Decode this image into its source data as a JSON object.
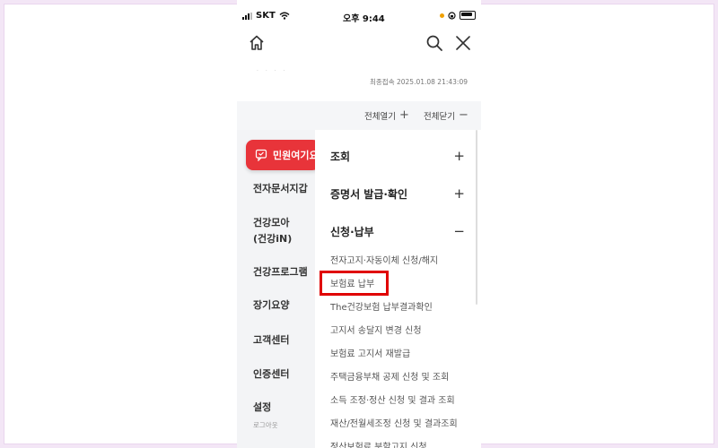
{
  "statusbar": {
    "carrier": "SKT",
    "time": "오후 9:44"
  },
  "topnav": {
    "home_icon": "home-icon",
    "search_icon": "search-icon",
    "close_icon": "close-icon"
  },
  "header": {
    "faint_text": "· · · ·",
    "last_login": "최종접속 2025.01.08 21:43:09"
  },
  "toolbar": {
    "open_all": "전체열기",
    "close_all": "전체닫기"
  },
  "complaint_tab": {
    "label": "민원여기요",
    "icon": "chat-icon",
    "color": "#e8343a"
  },
  "sidebar": {
    "items": [
      {
        "label": "전자문서지갑"
      },
      {
        "label": "건강모아",
        "sub": "(건강iN)"
      },
      {
        "label": "건강프로그램"
      },
      {
        "label": "장기요양"
      },
      {
        "label": "고객센터"
      },
      {
        "label": "인증센터"
      },
      {
        "label": "설정",
        "sub": "로그아웃"
      }
    ]
  },
  "content": {
    "sections": [
      {
        "label": "조회",
        "toggle": "+"
      },
      {
        "label": "증명서 발급·확인",
        "toggle": "+"
      },
      {
        "label": "신청·납부",
        "toggle": "−"
      }
    ],
    "sub_items": [
      "전자고지·자동이체 신청/해지",
      "보험료 납부",
      "The건강보험 납부결과확인",
      "고지서 송달지 변경 신청",
      "보험료 고지서 재발급",
      "주택금융부채 공제 신청 및 조회",
      "소득 조정·정산 신청 및 결과 조회",
      "재산/전월세조정 신청 및 결과조회",
      "정산보험료 분할고지 신청"
    ],
    "highlighted_item": "보험료 납부",
    "highlight_color": "#e00000"
  }
}
